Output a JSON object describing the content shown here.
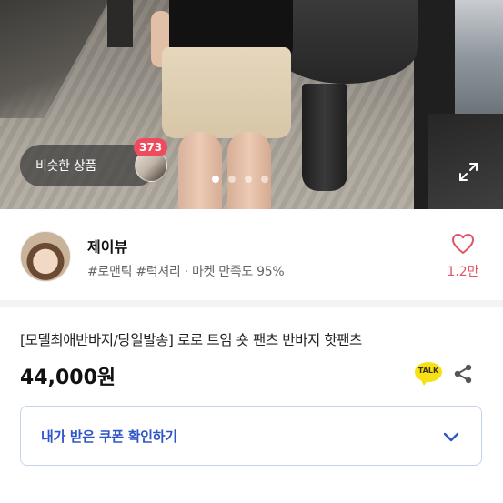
{
  "hero": {
    "similar_products_label": "비슷한 상품",
    "similar_products_count": "373",
    "carousel_total": 4,
    "carousel_active": 1,
    "expand_icon": "expand-icon"
  },
  "seller": {
    "name": "제이뷰",
    "tags": "#로맨틱 #럭셔리 · 마켓 만족도 95%",
    "like_count": "1.2만"
  },
  "product": {
    "title": "[모델최애반바지/당일발송] 로로 트임 숏 팬츠 반바지 핫팬츠",
    "price": "44,000원",
    "talk_label": "TALK"
  },
  "coupon": {
    "label": "내가 받은 쿠폰 확인하기"
  },
  "colors": {
    "accent_blue": "#2f55c8",
    "badge_red": "#ef4b5f",
    "like_pink": "#e25567",
    "kakao_yellow": "#f7e115"
  }
}
